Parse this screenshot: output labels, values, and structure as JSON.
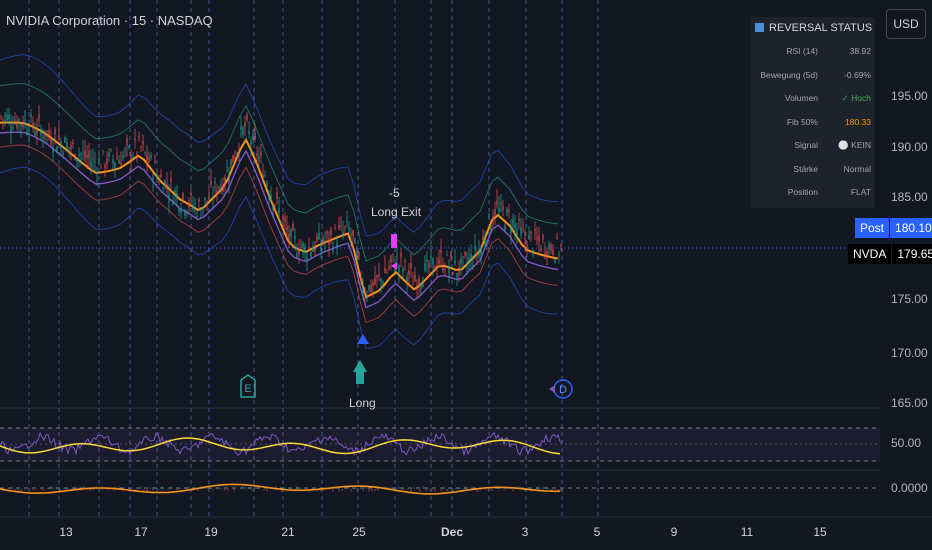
{
  "header": {
    "title": "NVIDIA Corporation · 15 · NASDAQ"
  },
  "currency_button": {
    "label": "USD"
  },
  "status_panel": {
    "icon": "bar-chart-icon",
    "title": "REVERSAL STATUS",
    "rows": [
      {
        "label": "RSI (14)",
        "value": "38.92",
        "color": "#a3a6af"
      },
      {
        "label": "Bewegung (5d)",
        "value": "-0.69%",
        "color": "#a3a6af"
      },
      {
        "label": "Volumen",
        "value": "✓ Hoch",
        "color": "#4caf50"
      },
      {
        "label": "Fib 50%",
        "value": "180.33",
        "color": "#ff9800"
      },
      {
        "label": "Signal",
        "value": "⚪ KEIN",
        "color": "#a3a6af"
      },
      {
        "label": "Stärke",
        "value": "Normal",
        "color": "#a3a6af"
      },
      {
        "label": "Position",
        "value": "FLAT",
        "color": "#a3a6af"
      }
    ]
  },
  "price_tags": {
    "post": {
      "label": "Post",
      "value": "180.10",
      "color": "#2962ff"
    },
    "last": {
      "label": "NVDA",
      "value": "179.65",
      "color": "#000000"
    }
  },
  "y_axis_main": [
    "195.00",
    "190.00",
    "185.00",
    "175.00",
    "170.00",
    "165.00"
  ],
  "y_axis_rsi": "50.00",
  "y_axis_osc": "0.0000",
  "x_axis": [
    "13",
    "17",
    "19",
    "21",
    "25",
    "Dec",
    "3",
    "5",
    "9",
    "11",
    "15"
  ],
  "annotations": {
    "exit_qty": "-5",
    "exit_label": "Long Exit",
    "entry_label": "Long",
    "marker_e": "E",
    "marker_d": "D"
  },
  "colors": {
    "background": "#131722",
    "orange_line": "#f7931a",
    "purple_line": "#7e57c2",
    "blue_band": "#2962ff",
    "rsi_line": "#7e57c2",
    "rsi_ma": "#fdd835",
    "up_candle": "#26a69a",
    "down_candle": "#ef5350"
  }
}
